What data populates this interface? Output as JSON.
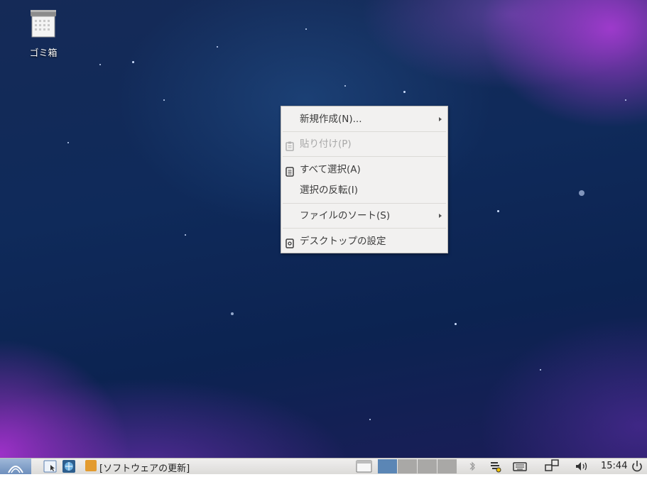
{
  "desktop": {
    "icons": [
      {
        "label": "ゴミ箱",
        "icon": "trash-icon"
      }
    ]
  },
  "context_menu": {
    "items": [
      {
        "label": "新規作成(N)...",
        "has_submenu": true,
        "enabled": true,
        "icon": null
      },
      {
        "label": "貼り付け(P)",
        "has_submenu": false,
        "enabled": false,
        "icon": "clipboard-icon"
      },
      {
        "label": "すべて選択(A)",
        "has_submenu": false,
        "enabled": true,
        "icon": "select-all-icon"
      },
      {
        "label": "選択の反転(I)",
        "has_submenu": false,
        "enabled": true,
        "icon": null
      },
      {
        "label": "ファイルのソート(S)",
        "has_submenu": true,
        "enabled": true,
        "icon": null
      },
      {
        "label": "デスクトップの設定",
        "has_submenu": false,
        "enabled": true,
        "icon": "desktop-settings-icon"
      }
    ]
  },
  "taskbar": {
    "task_window_label": "[ソフトウェアの更新]",
    "clock": "15:44",
    "launchers": [
      "file-manager-icon",
      "browser-icon"
    ],
    "tray": [
      "bluetooth-icon",
      "network-icon",
      "keyboard-icon",
      "display-icon",
      "volume-icon",
      "power-icon"
    ]
  },
  "colors": {
    "menu_bg": "#f2f1f0",
    "taskbar_bg": "#e6e5e3",
    "workspace_active": "#5b86b5"
  }
}
